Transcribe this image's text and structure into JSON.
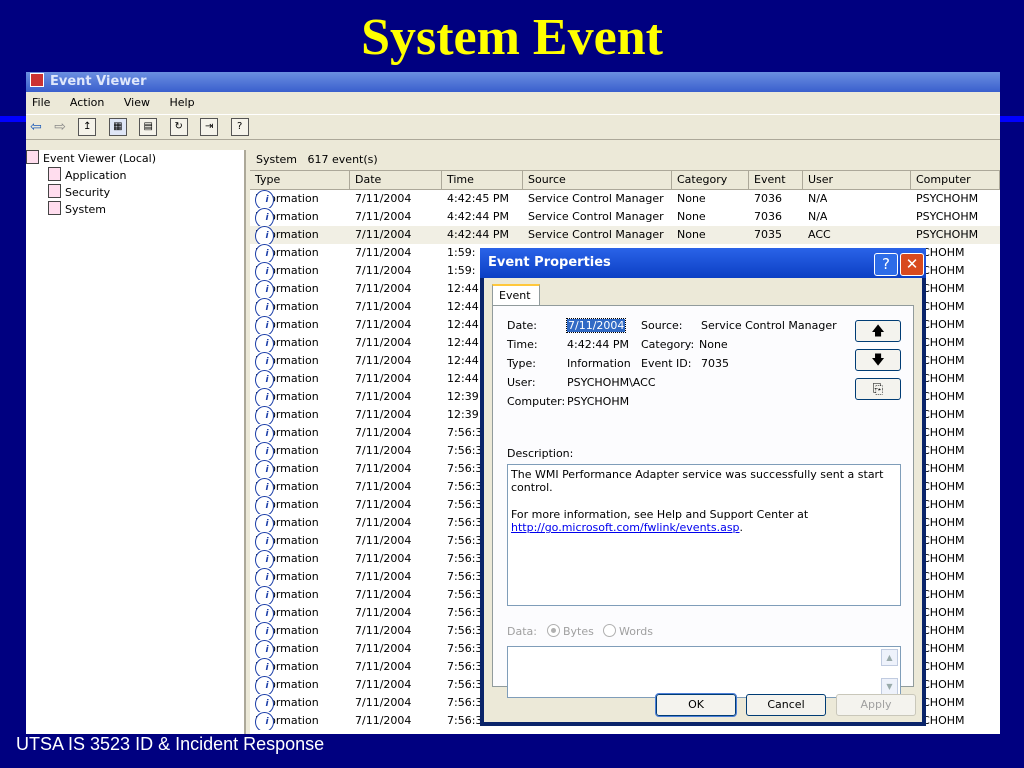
{
  "slide": {
    "title": "System Event",
    "footer": "UTSA IS 3523 ID & Incident Response"
  },
  "window": {
    "title": "Event Viewer",
    "menu": [
      "File",
      "Action",
      "View",
      "Help"
    ]
  },
  "tree": {
    "root": "Event Viewer (Local)",
    "items": [
      "Application",
      "Security",
      "System"
    ]
  },
  "list": {
    "header_name": "System",
    "header_count": "617 event(s)",
    "columns": [
      "Type",
      "Date",
      "Time",
      "Source",
      "Category",
      "Event",
      "User",
      "Computer"
    ],
    "rows": [
      {
        "type": "Information",
        "date": "7/11/2004",
        "time": "4:42:45 PM",
        "source": "Service Control Manager",
        "category": "None",
        "event": "7036",
        "user": "N/A",
        "computer": "PSYCHOHM"
      },
      {
        "type": "Information",
        "date": "7/11/2004",
        "time": "4:42:44 PM",
        "source": "Service Control Manager",
        "category": "None",
        "event": "7036",
        "user": "N/A",
        "computer": "PSYCHOHM"
      },
      {
        "type": "Information",
        "date": "7/11/2004",
        "time": "4:42:44 PM",
        "source": "Service Control Manager",
        "category": "None",
        "event": "7035",
        "user": "ACC",
        "computer": "PSYCHOHM"
      },
      {
        "type": "Information",
        "date": "7/11/2004",
        "time": "1:59:",
        "source": "",
        "category": "",
        "event": "",
        "user": "",
        "computer": "YCHOHM"
      },
      {
        "type": "Information",
        "date": "7/11/2004",
        "time": "1:59:",
        "source": "",
        "category": "",
        "event": "",
        "user": "",
        "computer": "YCHOHM"
      },
      {
        "type": "Information",
        "date": "7/11/2004",
        "time": "12:44",
        "source": "",
        "category": "",
        "event": "",
        "user": "",
        "computer": "YCHOHM"
      },
      {
        "type": "Information",
        "date": "7/11/2004",
        "time": "12:44",
        "source": "",
        "category": "",
        "event": "",
        "user": "",
        "computer": "YCHOHM"
      },
      {
        "type": "Information",
        "date": "7/11/2004",
        "time": "12:44",
        "source": "",
        "category": "",
        "event": "",
        "user": "",
        "computer": "YCHOHM"
      },
      {
        "type": "Information",
        "date": "7/11/2004",
        "time": "12:44",
        "source": "",
        "category": "",
        "event": "",
        "user": "",
        "computer": "YCHOHM"
      },
      {
        "type": "Information",
        "date": "7/11/2004",
        "time": "12:44",
        "source": "",
        "category": "",
        "event": "",
        "user": "",
        "computer": "YCHOHM"
      },
      {
        "type": "Information",
        "date": "7/11/2004",
        "time": "12:44",
        "source": "",
        "category": "",
        "event": "",
        "user": "",
        "computer": "YCHOHM"
      },
      {
        "type": "Information",
        "date": "7/11/2004",
        "time": "12:39",
        "source": "",
        "category": "",
        "event": "",
        "user": "",
        "computer": "YCHOHM"
      },
      {
        "type": "Information",
        "date": "7/11/2004",
        "time": "12:39",
        "source": "",
        "category": "",
        "event": "",
        "user": "",
        "computer": "YCHOHM"
      },
      {
        "type": "Information",
        "date": "7/11/2004",
        "time": "7:56:3",
        "source": "",
        "category": "",
        "event": "",
        "user": "",
        "computer": "YCHOHM"
      },
      {
        "type": "Information",
        "date": "7/11/2004",
        "time": "7:56:3",
        "source": "",
        "category": "",
        "event": "",
        "user": "",
        "computer": "YCHOHM"
      },
      {
        "type": "Information",
        "date": "7/11/2004",
        "time": "7:56:3",
        "source": "",
        "category": "",
        "event": "",
        "user": "",
        "computer": "YCHOHM"
      },
      {
        "type": "Information",
        "date": "7/11/2004",
        "time": "7:56:3",
        "source": "",
        "category": "",
        "event": "",
        "user": "",
        "computer": "YCHOHM"
      },
      {
        "type": "Information",
        "date": "7/11/2004",
        "time": "7:56:3",
        "source": "",
        "category": "",
        "event": "",
        "user": "",
        "computer": "YCHOHM"
      },
      {
        "type": "Information",
        "date": "7/11/2004",
        "time": "7:56:3",
        "source": "",
        "category": "",
        "event": "",
        "user": "",
        "computer": "YCHOHM"
      },
      {
        "type": "Information",
        "date": "7/11/2004",
        "time": "7:56:3",
        "source": "",
        "category": "",
        "event": "",
        "user": "",
        "computer": "YCHOHM"
      },
      {
        "type": "Information",
        "date": "7/11/2004",
        "time": "7:56:3",
        "source": "",
        "category": "",
        "event": "",
        "user": "",
        "computer": "YCHOHM"
      },
      {
        "type": "Information",
        "date": "7/11/2004",
        "time": "7:56:3",
        "source": "",
        "category": "",
        "event": "",
        "user": "",
        "computer": "YCHOHM"
      },
      {
        "type": "Information",
        "date": "7/11/2004",
        "time": "7:56:3",
        "source": "",
        "category": "",
        "event": "",
        "user": "",
        "computer": "YCHOHM"
      },
      {
        "type": "Information",
        "date": "7/11/2004",
        "time": "7:56:3",
        "source": "",
        "category": "",
        "event": "",
        "user": "",
        "computer": "YCHOHM"
      },
      {
        "type": "Information",
        "date": "7/11/2004",
        "time": "7:56:3",
        "source": "",
        "category": "",
        "event": "",
        "user": "",
        "computer": "YCHOHM"
      },
      {
        "type": "Information",
        "date": "7/11/2004",
        "time": "7:56:3",
        "source": "",
        "category": "",
        "event": "",
        "user": "",
        "computer": "YCHOHM"
      },
      {
        "type": "Information",
        "date": "7/11/2004",
        "time": "7:56:3",
        "source": "",
        "category": "",
        "event": "",
        "user": "",
        "computer": "YCHOHM"
      },
      {
        "type": "Information",
        "date": "7/11/2004",
        "time": "7:56:3",
        "source": "",
        "category": "",
        "event": "",
        "user": "",
        "computer": "YCHOHM"
      },
      {
        "type": "Information",
        "date": "7/11/2004",
        "time": "7:56:3",
        "source": "",
        "category": "",
        "event": "",
        "user": "",
        "computer": "YCHOHM"
      },
      {
        "type": "Information",
        "date": "7/11/2004",
        "time": "7:56:3",
        "source": "",
        "category": "",
        "event": "",
        "user": "",
        "computer": "YCHOHM"
      }
    ]
  },
  "dialog": {
    "title": "Event Properties",
    "help_glyph": "?",
    "close_glyph": "✕",
    "tab": "Event",
    "date_label": "Date:",
    "date_value": "7/11/2004",
    "source_label": "Source:",
    "source_value": "Service Control Manager",
    "time_label": "Time:",
    "time_value": "4:42:44 PM",
    "category_label": "Category:",
    "category_value": "None",
    "type_label": "Type:",
    "type_value": "Information",
    "eventid_label": "Event ID:",
    "eventid_value": "7035",
    "user_label": "User:",
    "user_value": "PSYCHOHM\\ACC",
    "computer_label": "Computer:",
    "computer_value": "PSYCHOHM",
    "description_label": "Description:",
    "description_text": "The WMI Performance Adapter service was successfully sent a start control.",
    "description_more": "For more information, see Help and Support Center at",
    "description_link": "http://go.microsoft.com/fwlink/events.asp",
    "description_link_tail": ".",
    "data_label": "Data:",
    "bytes_label": "Bytes",
    "words_label": "Words",
    "up_glyph": "🡅",
    "down_glyph": "🡇",
    "copy_glyph": "⎘",
    "ok_label": "OK",
    "cancel_label": "Cancel",
    "apply_label": "Apply"
  }
}
